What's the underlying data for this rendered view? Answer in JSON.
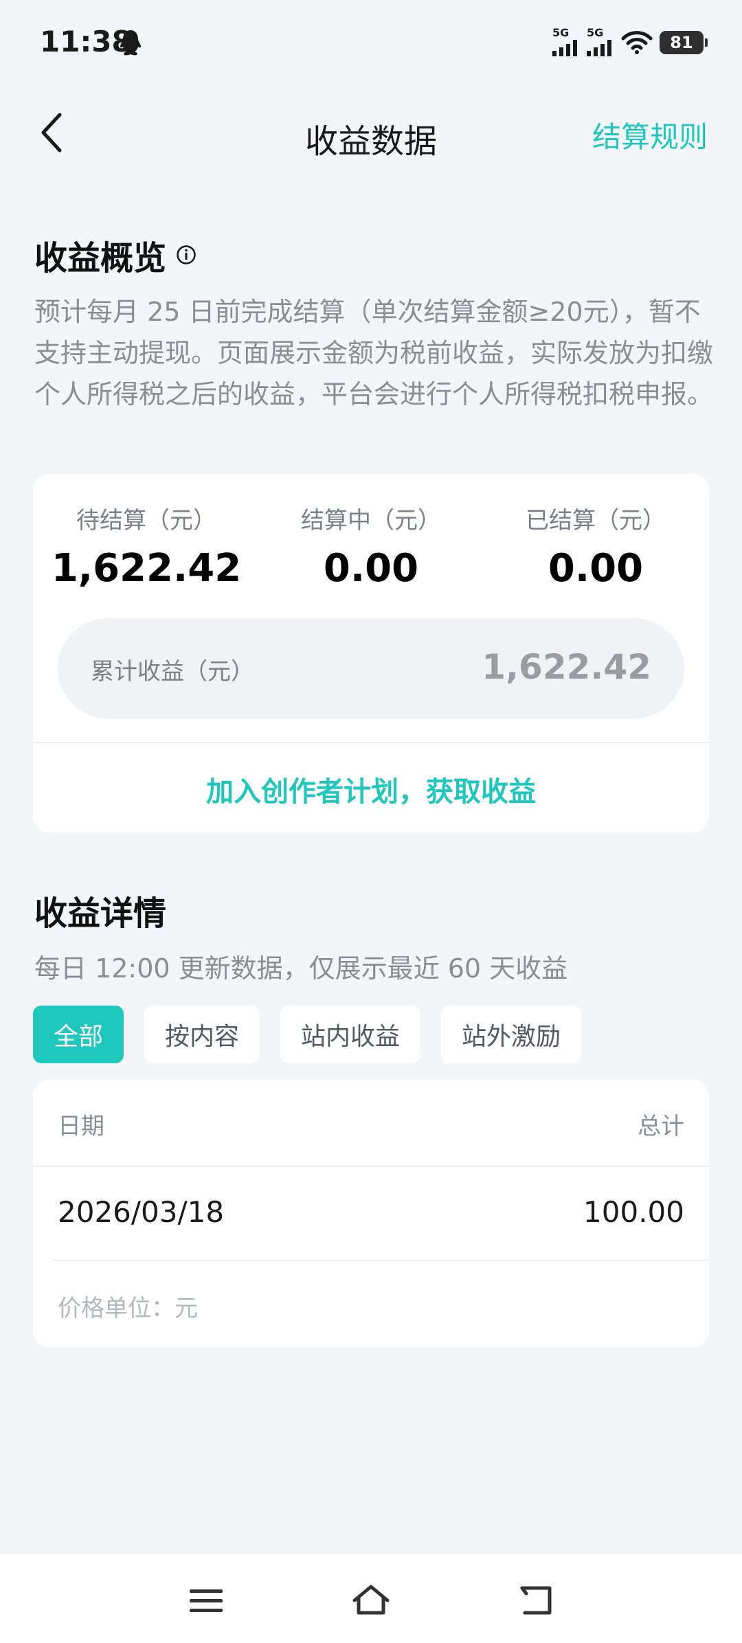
{
  "status_bar": {
    "time": "11:38",
    "signal_label_1": "5G",
    "signal_label_2": "5G",
    "battery": "81"
  },
  "header": {
    "title": "收益数据",
    "rule_link": "结算规则"
  },
  "overview": {
    "title": "收益概览",
    "description": "预计每月 25 日前完成结算（单次结算金额≥20元），暂不支持主动提现。页面展示金额为税前收益，实际发放为扣缴个人所得税之后的收益，平台会进行个人所得税扣税申报。",
    "stats": [
      {
        "label": "待结算（元）",
        "value": "1,622.42"
      },
      {
        "label": "结算中（元）",
        "value": "0.00"
      },
      {
        "label": "已结算（元）",
        "value": "0.00"
      }
    ],
    "total_label": "累计收益（元）",
    "total_value": "1,622.42",
    "join_link": "加入创作者计划，获取收益"
  },
  "details": {
    "title": "收益详情",
    "subtitle": "每日 12:00 更新数据，仅展示最近 60 天收益",
    "filters": [
      "全部",
      "按内容",
      "站内收益",
      "站外激励"
    ],
    "table": {
      "col_date": "日期",
      "col_total": "总计",
      "rows": [
        {
          "date": "2026/03/18",
          "total": "100.00"
        }
      ],
      "unit_note": "价格单位：元"
    }
  },
  "colors": {
    "accent": "#1ec8bd",
    "background": "#f4f5f9"
  }
}
